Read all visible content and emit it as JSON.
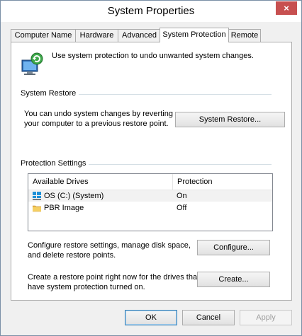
{
  "window": {
    "title": "System Properties",
    "close_glyph": "×"
  },
  "tabs": [
    {
      "label": "Computer Name"
    },
    {
      "label": "Hardware"
    },
    {
      "label": "Advanced"
    },
    {
      "label": "System Protection"
    },
    {
      "label": "Remote"
    }
  ],
  "header": {
    "description": "Use system protection to undo unwanted system changes.",
    "icon": "system-protection-icon"
  },
  "system_restore": {
    "group_label": "System Restore",
    "text_line1": "You can undo system changes by reverting",
    "text_line2": "your computer to a previous restore point.",
    "button": "System Restore..."
  },
  "protection": {
    "group_label": "Protection Settings",
    "columns": [
      "Available Drives",
      "Protection"
    ],
    "drives": [
      {
        "name": "OS (C:) (System)",
        "protection": "On",
        "icon": "windows-drive-icon"
      },
      {
        "name": "PBR Image",
        "protection": "Off",
        "icon": "folder-drive-icon"
      }
    ],
    "configure_line1": "Configure restore settings, manage disk space,",
    "configure_line2": "and delete restore points.",
    "configure_button": "Configure...",
    "create_line1": "Create a restore point right now for the drives that",
    "create_line2": "have system protection turned on.",
    "create_button": "Create..."
  },
  "footer": {
    "ok": "OK",
    "cancel": "Cancel",
    "apply": "Apply"
  },
  "colors": {
    "accent": "#3c7fb1",
    "close": "#c75050",
    "selected_row": "#f2f2f2"
  }
}
